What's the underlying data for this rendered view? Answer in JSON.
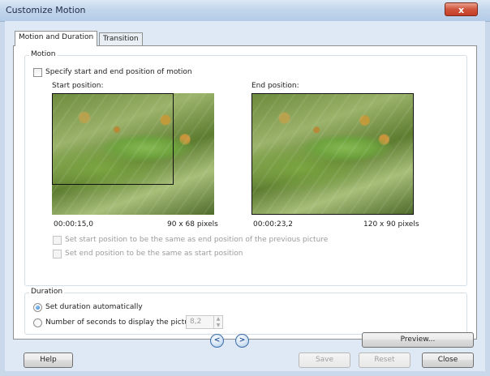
{
  "window": {
    "title": "Customize Motion",
    "close_glyph": "x"
  },
  "tabs": [
    {
      "label": "Motion and Duration",
      "active": true
    },
    {
      "label": "Transition",
      "active": false
    }
  ],
  "motion": {
    "legend": "Motion",
    "specify_label": "Specify start and end position of motion",
    "specify_checked": false,
    "start": {
      "label": "Start position:",
      "time": "00:00:15,0",
      "size": "90 x 68 pixels"
    },
    "end": {
      "label": "End position:",
      "time": "00:00:23,2",
      "size": "120 x 90 pixels"
    },
    "opt_start_same": "Set start position to be the same as end position of the previous picture",
    "opt_end_same": "Set end position to be the same as start position"
  },
  "duration": {
    "legend": "Duration",
    "auto_label": "Set duration automatically",
    "auto_selected": true,
    "seconds_label": "Number of seconds to display the picture",
    "seconds_value": "8,2"
  },
  "buttons": {
    "preview": "Preview...",
    "help": "Help",
    "save": "Save",
    "reset": "Reset",
    "close": "Close",
    "prev_glyph": "<",
    "next_glyph": ">"
  },
  "colors": {
    "accent": "#1b6fc4",
    "titlebar": "#c3d6ec",
    "close": "#c33e26"
  }
}
